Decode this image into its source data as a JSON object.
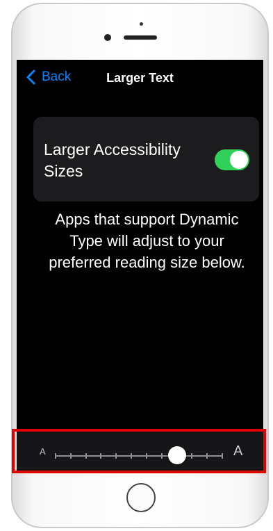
{
  "nav": {
    "back_label": "Back",
    "title": "Larger Text"
  },
  "accessibility": {
    "toggle_label": "Larger Accessibility Sizes",
    "toggle_on": true
  },
  "description": "Apps that support Dynamic Type will adjust to your preferred reading size below.",
  "text_size_slider": {
    "min_label": "A",
    "max_label": "A",
    "step_count": 12,
    "selected_step": 8
  },
  "colors": {
    "accent": "#0a84ff",
    "toggle_on": "#30d158",
    "highlight": "#e00000"
  },
  "icons": {
    "back": "chevron-left-icon"
  }
}
